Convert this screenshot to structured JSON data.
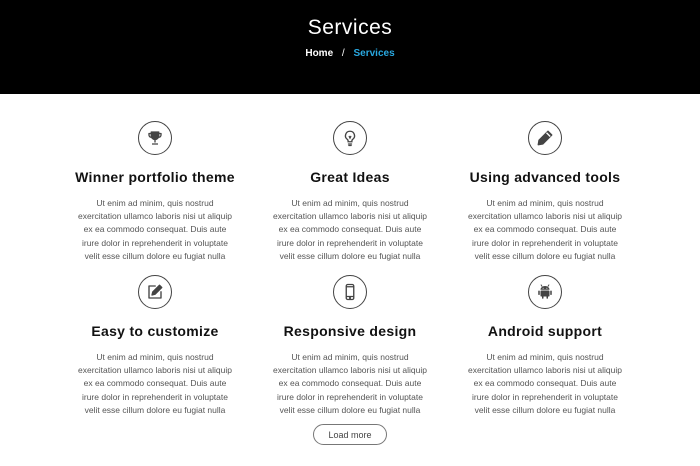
{
  "header": {
    "title": "Services",
    "breadcrumb": {
      "home": "Home",
      "separator": "/",
      "current": "Services"
    }
  },
  "colors": {
    "hero_bg": "#000000",
    "breadcrumb_active": "#29a8e0",
    "icon_stroke": "#444444"
  },
  "services": [
    {
      "icon": "trophy-icon",
      "title": "Winner portfolio theme",
      "desc": [
        "Ut enim ad minim, quis nostrud",
        "exercitation ullamco laboris nisi ut aliquip",
        "ex ea commodo consequat. Duis aute",
        "irure dolor in reprehenderit in voluptate",
        "velit esse cillum dolore eu fugiat nulla"
      ]
    },
    {
      "icon": "lightbulb-icon",
      "title": "Great Ideas",
      "desc": [
        "Ut enim ad minim, quis nostrud",
        "exercitation ullamco laboris nisi ut aliquip",
        "ex ea commodo consequat. Duis aute",
        "irure dolor in reprehenderit in voluptate",
        "velit esse cillum dolore eu fugiat nulla"
      ]
    },
    {
      "icon": "pencil-icon",
      "title": "Using advanced tools",
      "desc": [
        "Ut enim ad minim, quis nostrud",
        "exercitation ullamco laboris nisi ut aliquip",
        "ex ea commodo consequat. Duis aute",
        "irure dolor in reprehenderit in voluptate",
        "velit esse cillum dolore eu fugiat nulla"
      ]
    },
    {
      "icon": "edit-icon",
      "title": "Easy to customize",
      "desc": [
        "Ut enim ad minim, quis nostrud",
        "exercitation ullamco laboris nisi ut aliquip",
        "ex ea commodo consequat. Duis aute",
        "irure dolor in reprehenderit in voluptate",
        "velit esse cillum dolore eu fugiat nulla"
      ]
    },
    {
      "icon": "mobile-phone-icon",
      "title": "Responsive design",
      "desc": [
        "Ut enim ad minim, quis nostrud",
        "exercitation ullamco laboris nisi ut aliquip",
        "ex ea commodo consequat. Duis aute",
        "irure dolor in reprehenderit in voluptate",
        "velit esse cillum dolore eu fugiat nulla"
      ]
    },
    {
      "icon": "android-icon",
      "title": "Android support",
      "desc": [
        "Ut enim ad minim, quis nostrud",
        "exercitation ullamco laboris nisi ut aliquip",
        "ex ea commodo consequat. Duis aute",
        "irure dolor in reprehenderit in voluptate",
        "velit esse cillum dolore eu fugiat nulla"
      ]
    }
  ],
  "load_more_label": "Load more"
}
